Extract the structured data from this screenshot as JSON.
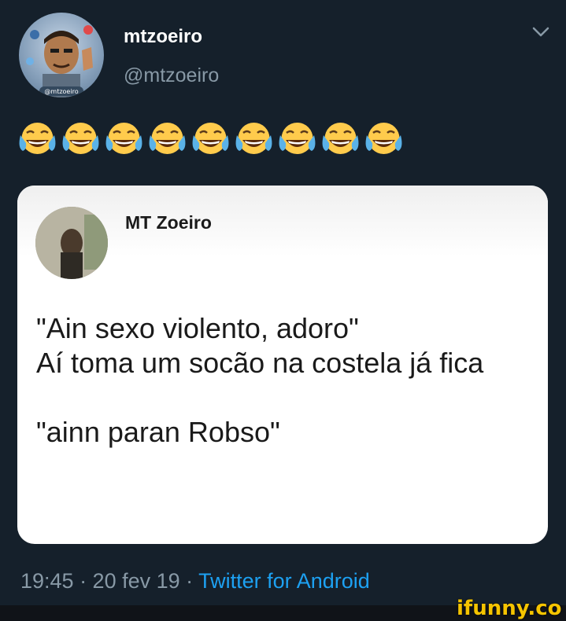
{
  "tweet": {
    "author_name": "mtzoeiro",
    "author_handle": "@mtzoeiro",
    "avatar_badge": "@mtzoeiro",
    "emoji_text": "😂😂😂😂😂😂😂😂😂",
    "quote": {
      "author_name": "MT Zoeiro",
      "lines": [
        "\"Ain sexo violento, adoro\"",
        "Aí toma um socão na costela já fica",
        "",
        "\"ainn paran Robso\""
      ]
    },
    "timestamp": "19:45 · 20 fev 19 · ",
    "source": "Twitter for Android"
  },
  "watermark": "ifunny.co",
  "icons": {
    "menu": "chevron-down-icon",
    "emoji": "face-with-tears-of-joy-emoji"
  },
  "colors": {
    "background": "#15202b",
    "accent": "#1da1f2",
    "secondary_text": "#8899a6",
    "watermark": "#f5c400"
  }
}
